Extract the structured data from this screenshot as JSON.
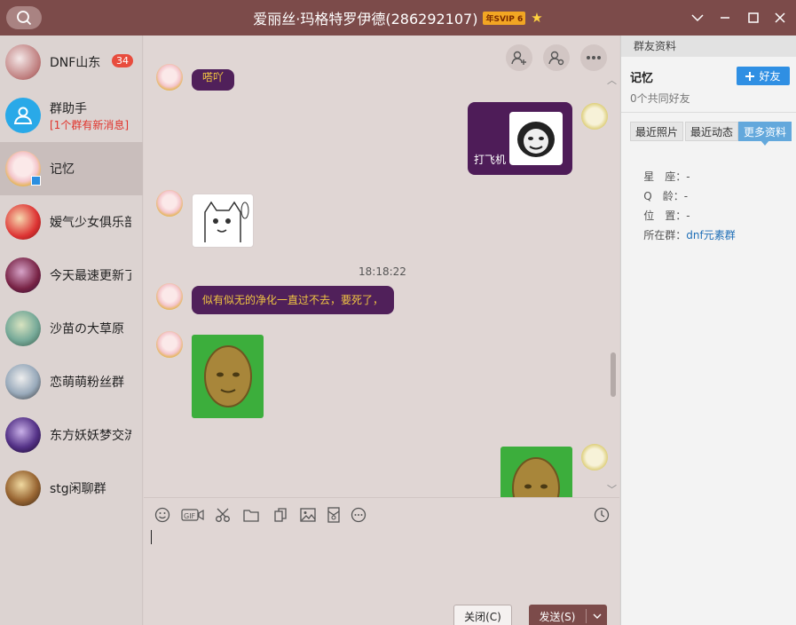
{
  "window": {
    "title": "爱丽丝·玛格特罗伊德(286292107)",
    "badge": "年SVIP 6",
    "star_icon": "star-icon",
    "accent": "#7c4b4a"
  },
  "conversations": [
    {
      "name": "DNF山东",
      "unread": "34",
      "subtitle": ""
    },
    {
      "name": "群助手",
      "unread": "",
      "subtitle": "[1个群有新消息]"
    },
    {
      "name": "记忆",
      "unread": "",
      "subtitle": "",
      "active": true
    },
    {
      "name": "嫒气少女俱乐部",
      "unread": "",
      "subtitle": ""
    },
    {
      "name": "今天最速更新了",
      "unread": "",
      "subtitle": ""
    },
    {
      "name": "沙苗の大草原",
      "unread": "",
      "subtitle": ""
    },
    {
      "name": "恋萌萌粉丝群",
      "unread": "",
      "subtitle": ""
    },
    {
      "name": "东方妖妖梦交流",
      "unread": "",
      "subtitle": ""
    },
    {
      "name": "stg闲聊群",
      "unread": "",
      "subtitle": ""
    }
  ],
  "chat": {
    "partial_message": "嗒吖",
    "self_sticker_caption": "打飞机",
    "timestamp": "18:18:22",
    "message": "似有似无的净化一直过不去，要死了，"
  },
  "input": {
    "close_label": "关闭(C)",
    "send_label": "发送(S)"
  },
  "profile": {
    "header": "群友资料",
    "name": "记忆",
    "add_friend_label": "好友",
    "common_friends": "0个共同好友",
    "tabs": [
      "最近照片",
      "最近动态",
      "更多资料"
    ],
    "rows": [
      {
        "label": "星　座：",
        "value": "-"
      },
      {
        "label": "Q　龄：",
        "value": "-"
      },
      {
        "label": "位　置：",
        "value": "-"
      },
      {
        "label": "所在群：",
        "value": "dnf元素群"
      }
    ]
  }
}
